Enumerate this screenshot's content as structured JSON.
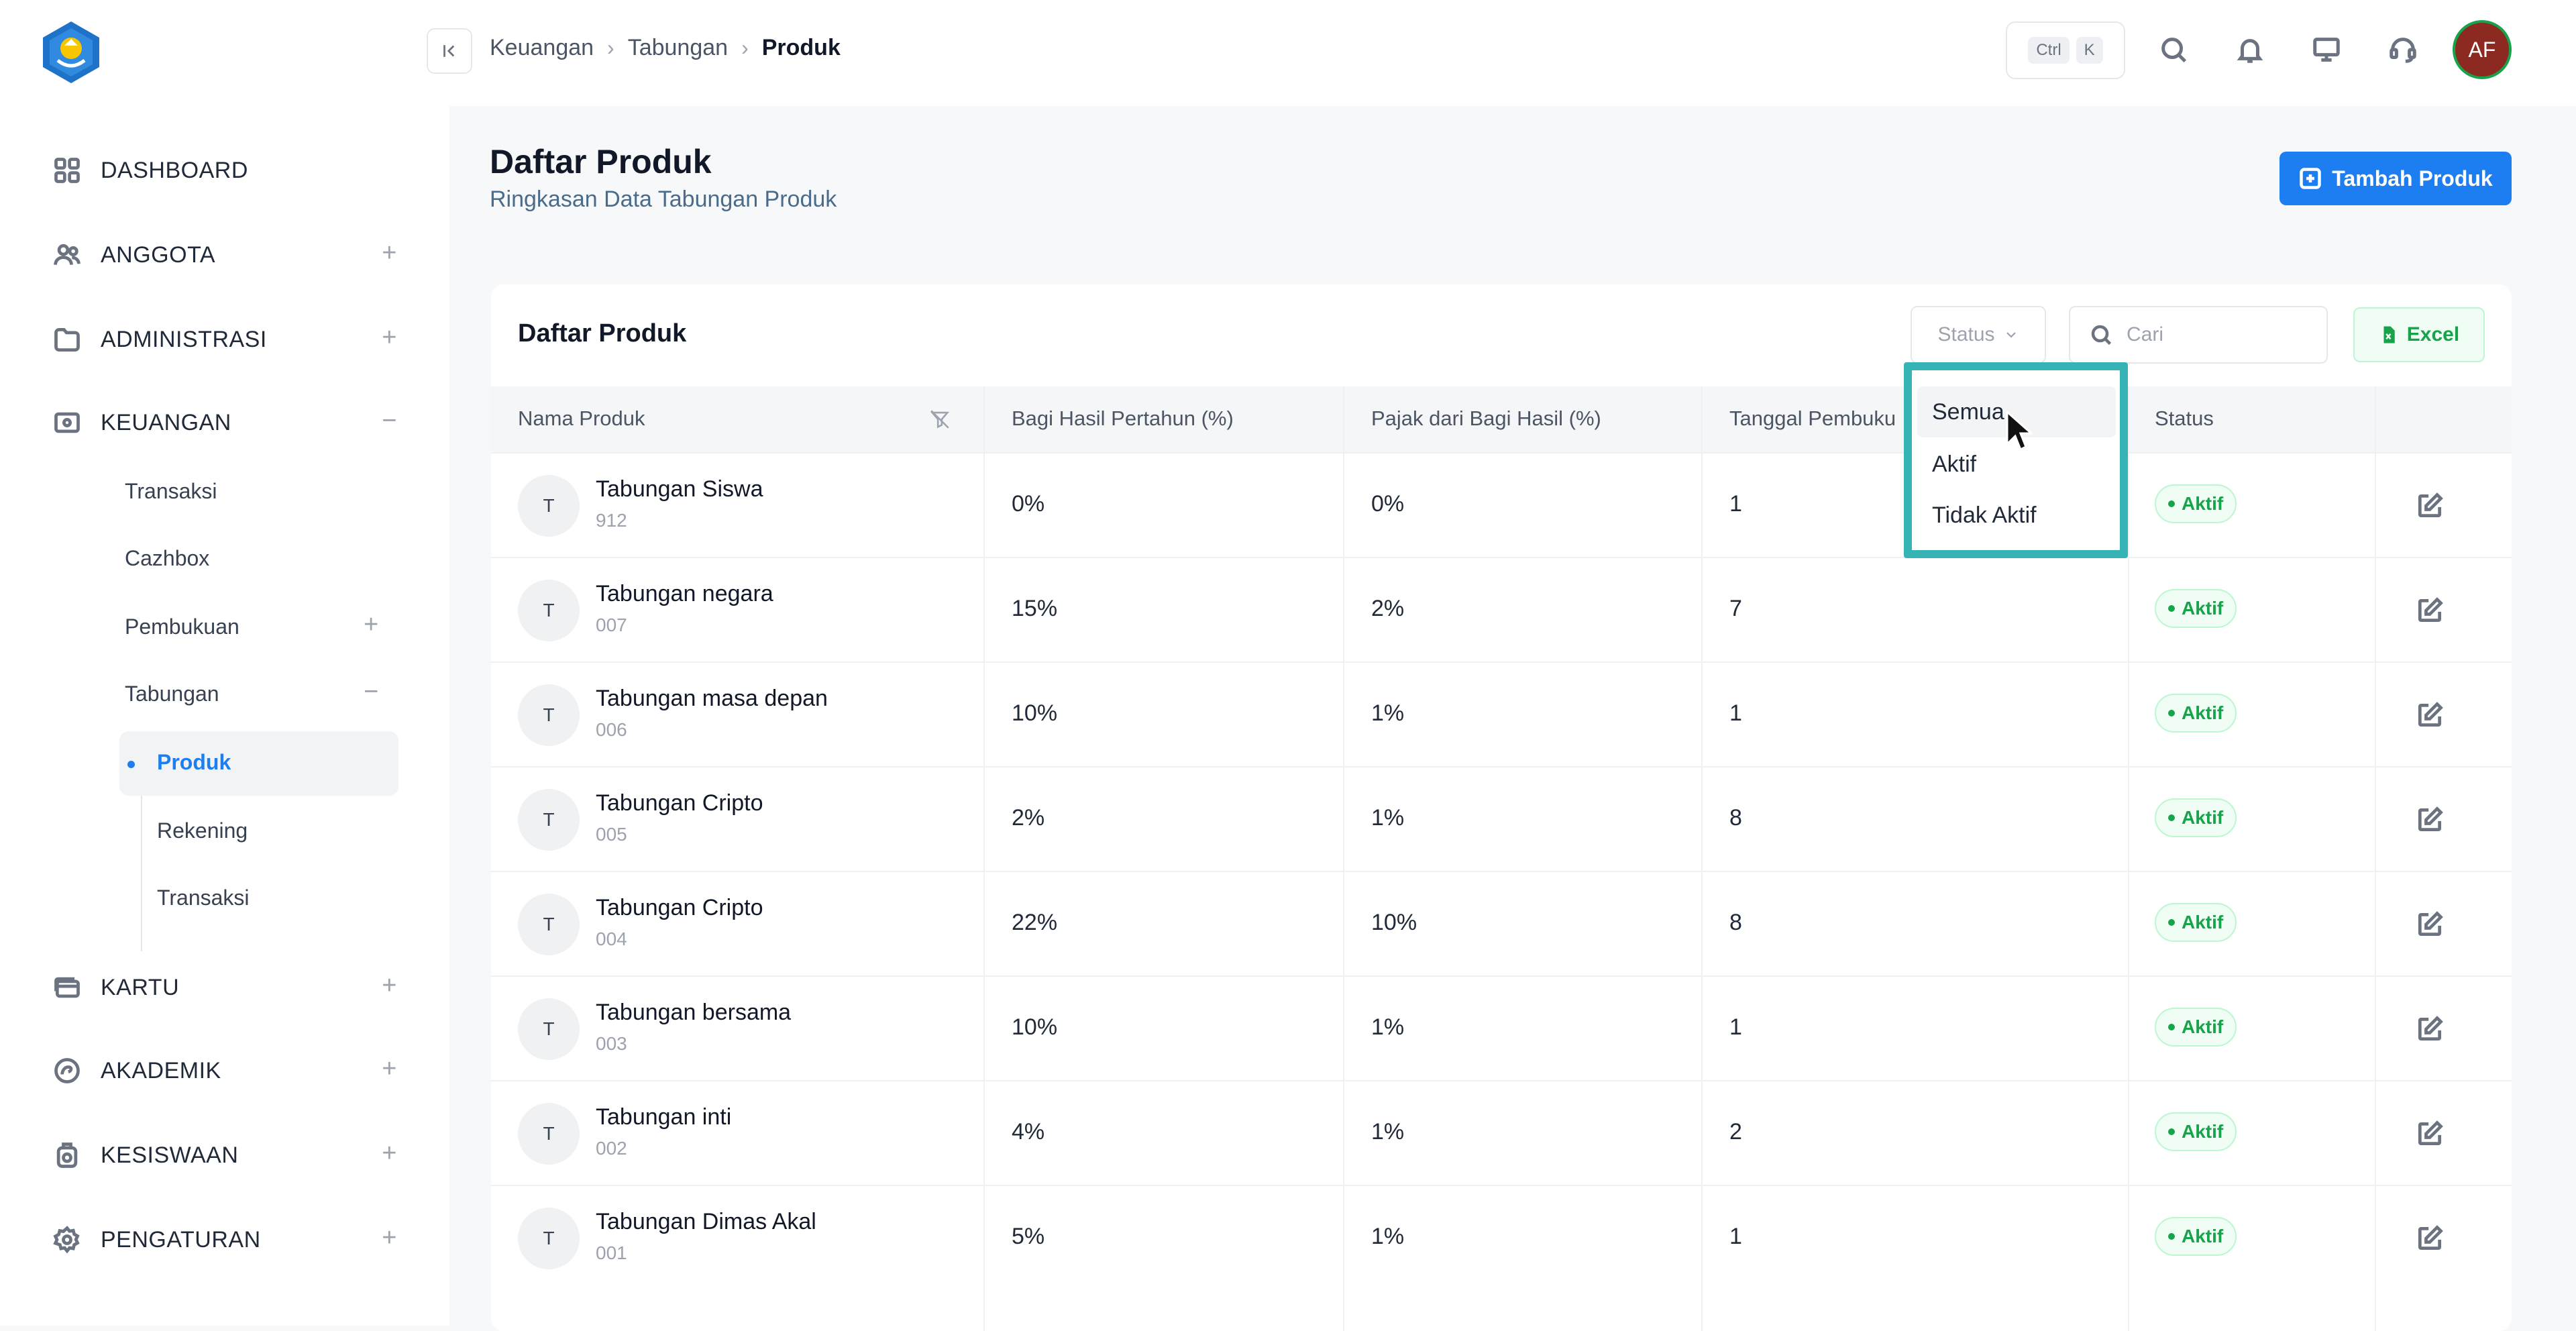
{
  "sidebar": {
    "items": [
      {
        "label": "DASHBOARD",
        "icon": "grid-icon",
        "toggle": ""
      },
      {
        "label": "ANGGOTA",
        "icon": "users-icon",
        "toggle": "+"
      },
      {
        "label": "ADMINISTRASI",
        "icon": "folder-icon",
        "toggle": "+"
      },
      {
        "label": "KEUANGAN",
        "icon": "wallet-icon",
        "toggle": "−"
      },
      {
        "label": "KARTU",
        "icon": "card-icon",
        "toggle": "+"
      },
      {
        "label": "AKADEMIK",
        "icon": "academic-icon",
        "toggle": "+"
      },
      {
        "label": "KESISWAAN",
        "icon": "student-icon",
        "toggle": "+"
      },
      {
        "label": "PENGATURAN",
        "icon": "gear-icon",
        "toggle": "+"
      }
    ],
    "keuangan_sub": [
      {
        "label": "Transaksi",
        "toggle": ""
      },
      {
        "label": "Cazhbox",
        "toggle": ""
      },
      {
        "label": "Pembukuan",
        "toggle": "+"
      },
      {
        "label": "Tabungan",
        "toggle": "−"
      }
    ],
    "tabungan_sub": [
      "Produk",
      "Rekening",
      "Transaksi"
    ]
  },
  "header": {
    "breadcrumb": [
      "Keuangan",
      "Tabungan",
      "Produk"
    ],
    "shortcut": [
      "Ctrl",
      "K"
    ],
    "avatar_initials": "AF"
  },
  "page": {
    "title": "Daftar Produk",
    "subtitle": "Ringkasan Data Tabungan Produk",
    "add_button": "Tambah Produk"
  },
  "card": {
    "title": "Daftar Produk",
    "status_placeholder": "Status",
    "search_placeholder": "Cari",
    "excel_label": "Excel"
  },
  "table": {
    "columns": [
      "Nama Produk",
      "Bagi Hasil Pertahun (%)",
      "Pajak dari Bagi Hasil (%)",
      "Tanggal Pembuku",
      "Status"
    ],
    "rows": [
      {
        "initial": "T",
        "name": "Tabungan Siswa",
        "code": "912",
        "bagi_hasil": "0%",
        "pajak": "0%",
        "tanggal": "1",
        "status": "Aktif"
      },
      {
        "initial": "T",
        "name": "Tabungan negara",
        "code": "007",
        "bagi_hasil": "15%",
        "pajak": "2%",
        "tanggal": "7",
        "status": "Aktif"
      },
      {
        "initial": "T",
        "name": "Tabungan masa depan",
        "code": "006",
        "bagi_hasil": "10%",
        "pajak": "1%",
        "tanggal": "1",
        "status": "Aktif"
      },
      {
        "initial": "T",
        "name": "Tabungan Cripto",
        "code": "005",
        "bagi_hasil": "2%",
        "pajak": "1%",
        "tanggal": "8",
        "status": "Aktif"
      },
      {
        "initial": "T",
        "name": "Tabungan Cripto",
        "code": "004",
        "bagi_hasil": "22%",
        "pajak": "10%",
        "tanggal": "8",
        "status": "Aktif"
      },
      {
        "initial": "T",
        "name": "Tabungan bersama",
        "code": "003",
        "bagi_hasil": "10%",
        "pajak": "1%",
        "tanggal": "1",
        "status": "Aktif"
      },
      {
        "initial": "T",
        "name": "Tabungan inti",
        "code": "002",
        "bagi_hasil": "4%",
        "pajak": "1%",
        "tanggal": "2",
        "status": "Aktif"
      },
      {
        "initial": "T",
        "name": "Tabungan Dimas Akal",
        "code": "001",
        "bagi_hasil": "5%",
        "pajak": "1%",
        "tanggal": "1",
        "status": "Aktif"
      }
    ]
  },
  "status_menu": {
    "options": [
      "Semua",
      "Aktif",
      "Tidak Aktif"
    ],
    "highlighted": "Semua"
  },
  "colors": {
    "primary": "#1d7ef2",
    "success": "#16a34a",
    "highlight_frame": "#36b3b5"
  }
}
